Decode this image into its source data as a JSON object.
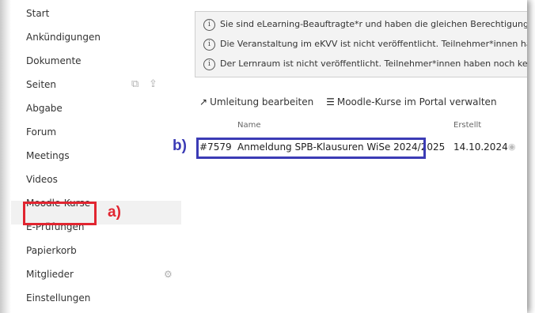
{
  "sidebar": {
    "items": [
      {
        "label": "Start"
      },
      {
        "label": "Ankündigungen"
      },
      {
        "label": "Dokumente"
      },
      {
        "label": "Seiten"
      },
      {
        "label": "Abgabe"
      },
      {
        "label": "Forum"
      },
      {
        "label": "Meetings"
      },
      {
        "label": "Videos"
      },
      {
        "label": "Moodle-Kurse"
      },
      {
        "label": "E-Prüfungen"
      },
      {
        "label": "Papierkorb"
      },
      {
        "label": "Mitglieder"
      },
      {
        "label": "Einstellungen"
      }
    ],
    "seiten_icons": [
      "copy-pages-icon",
      "upload-icon"
    ],
    "mitglieder_icon": "gear-icon"
  },
  "notices": [
    "Sie sind eLearning-Beauftragte*r und haben die gleichen Berechtigungen",
    "Die Veranstaltung im eKVV ist nicht veröffentlicht. Teilnehmer*innen habe",
    "Der Lernraum ist nicht veröffentlicht. Teilnehmer*innen haben noch keine"
  ],
  "actions": {
    "redirect_label": "Umleitung bearbeiten",
    "manage_label": "Moodle-Kurse im Portal verwalten"
  },
  "table": {
    "headers": {
      "name": "Name",
      "created": "Erstellt"
    },
    "rows": [
      {
        "id": "#7579",
        "name": "Anmeldung SPB-Klausuren WiSe 2024/2025",
        "created": "14.10.2024"
      }
    ]
  },
  "annotations": {
    "a": "a)",
    "b": "b)",
    "a_color": "#e12530",
    "b_color": "#3b3bb5"
  }
}
